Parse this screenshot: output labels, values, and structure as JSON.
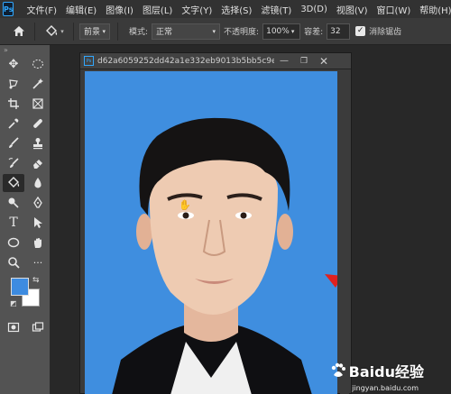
{
  "app": {
    "logo": "Ps"
  },
  "menu": [
    "文件(F)",
    "编辑(E)",
    "图像(I)",
    "图层(L)",
    "文字(Y)",
    "选择(S)",
    "滤镜(T)",
    "3D(D)",
    "视图(V)",
    "窗口(W)",
    "帮助(H)"
  ],
  "options": {
    "fill_source": "前景",
    "mode_label": "模式:",
    "mode_value": "正常",
    "opacity_label": "不透明度:",
    "opacity_value": "100%",
    "tolerance_label": "容差:",
    "tolerance_value": "32",
    "antialias_label": "消除锯齿"
  },
  "document": {
    "title": "d62a6059252dd42a1e332eb9013b5bb5c9e...",
    "background_color": "#3f8edf"
  },
  "swatches": {
    "foreground": "#3d8be0",
    "background": "#ffffff"
  },
  "watermark": {
    "brand": "Baidu经验",
    "url": "jingyan.baidu.com"
  },
  "icons": [
    "home-icon",
    "paint-bucket-icon",
    "move-icon",
    "marquee-icon",
    "lasso-icon",
    "magic-wand-icon",
    "crop-icon",
    "frame-icon",
    "eyedropper-icon",
    "healing-icon",
    "brush-icon",
    "stamp-icon",
    "history-brush-icon",
    "eraser-icon",
    "paint-bucket-icon",
    "blur-icon",
    "dodge-icon",
    "pen-icon",
    "type-icon",
    "path-select-icon",
    "ellipse-icon",
    "hand-icon",
    "zoom-icon"
  ]
}
